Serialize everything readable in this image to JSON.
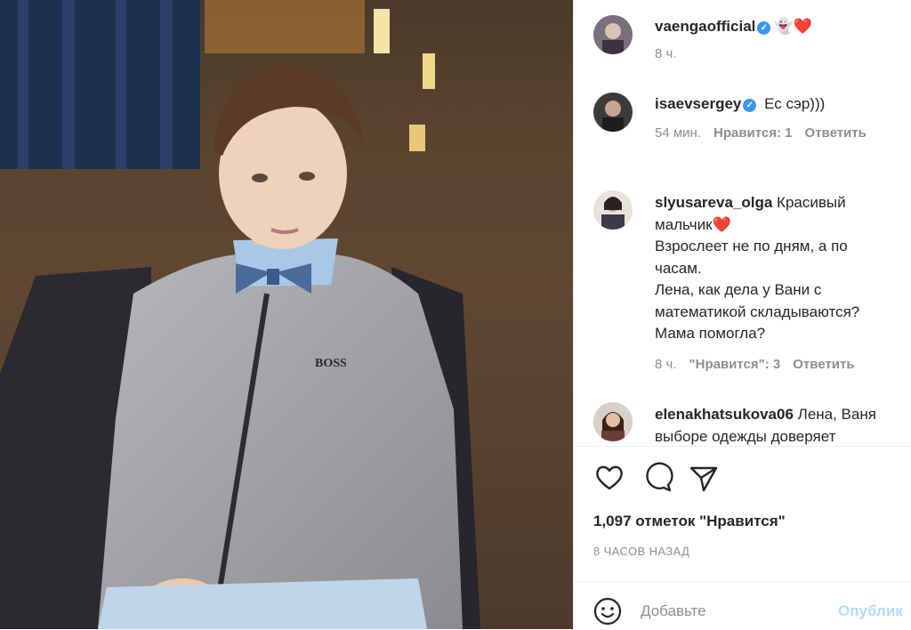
{
  "photo": {
    "alt_icon": "photo-of-boy-in-bow-tie",
    "sweater_logo": "BOSS"
  },
  "comments": [
    {
      "user": "vaengaofficial",
      "verified": true,
      "text": "👻❤️",
      "time": "8 ч.",
      "likes": "",
      "reply": ""
    },
    {
      "user": "isaevsergey",
      "verified": true,
      "text": "Ес сэр)))",
      "time": "54 мин.",
      "likes": "Нравится: 1",
      "reply": "Ответить"
    },
    {
      "user": "slyusareva_olga",
      "verified": false,
      "text_lines": [
        "Красивый",
        "мальчик❤️",
        "Взрослеет не по дням, а по",
        "часам.",
        "Лена, как дела у Вани с",
        "математикой складываются?",
        "Мама помогла?"
      ],
      "time": "8 ч.",
      "likes": "\"Нравится\": 3",
      "reply": "Ответить"
    },
    {
      "user": "elenakhatsukova06",
      "verified": false,
      "text_lines": [
        "Лена, Ваня",
        "выборе одежды доверяет"
      ],
      "time": "",
      "likes": "",
      "reply": ""
    }
  ],
  "actions": {
    "like_icon": "heart-icon",
    "comment_icon": "comment-icon",
    "share_icon": "share-icon"
  },
  "likes_count": "1,097 отметок \"Нравится\"",
  "post_time": "8 ЧАСОВ НАЗАД",
  "add_comment": {
    "emoji_icon": "emoji-icon",
    "placeholder": "Добавьте",
    "post_label": "Опублик"
  },
  "colors": {
    "verified": "#3897f0",
    "muted": "#8e8e8e",
    "post_disabled": "#b3dbff"
  }
}
